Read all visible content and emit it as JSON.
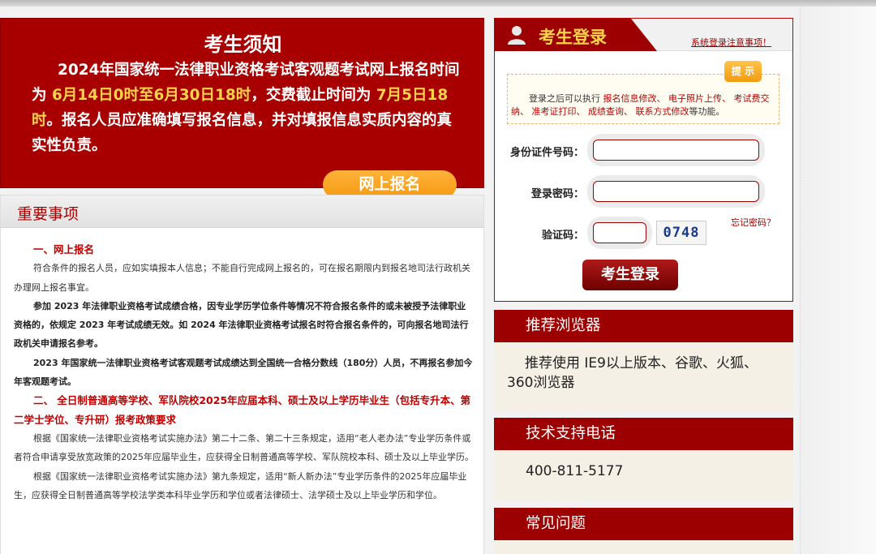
{
  "notice": {
    "title": "考生须知",
    "text_1": "2024年国家统一法律职业资格考试客观题考试网上报名时间为 ",
    "highlight_1": "6月14日0时至6月30日18时",
    "text_2": "，交费截止时间为 ",
    "highlight_2": "7月5日18时",
    "text_3": "。报名人员应准确填写报名信息，并对填报信息实质内容的真实性负责。",
    "enroll_button": "网上报名"
  },
  "matters": {
    "title": "重要事项",
    "section_1": "一、网上报名",
    "para_1": "符合条件的报名人员，应如实填报本人信息；不能自行完成网上报名的，可在报名期限内到报名地司法行政机关办理网上报名事宜。",
    "para_2": "参加 2023 年法律职业资格考试成绩合格，因专业学历学位条件等情况不符合报名条件的或未被授予法律职业资格的，依规定 2023 年考试成绩无效。如 2024 年法律职业资格考试报名时符合报名条件的，可向报名地司法行政机关申请报名参考。",
    "para_3": "2023 年国家统一法律职业资格考试客观题考试成绩达到全国统一合格分数线（180分）人员，不再报名参加今年客观题考试。",
    "section_2": "二、 全日制普通高等学校、军队院校2025年应届本科、硕士及以上学历毕业生（包括专升本、第二学士学位、专升研）报考政策要求",
    "para_4": "根据《国家统一法律职业资格考试实施办法》第二十二条、第二十三条规定，适用“老人老办法”专业学历条件或者符合申请享受放宽政策的2025年应届毕业生，应获得全日制普通高等学校、军队院校本科、硕士及以上毕业学历。",
    "para_5": "根据《国家统一法律职业资格考试实施办法》第九条规定，适用“新人新办法”专业学历条件的2025年应届毕业生，应获得全日制普通高等学校法学类本科毕业学历和学位或者法律硕士、法学硕士及以上毕业学历和学位。"
  },
  "login": {
    "title": "考生登录",
    "notice_link": "系统登录注意事项！",
    "tip_badge": "提 示",
    "tip_prefix": "登录之后可以执行 ",
    "tip_item_1": "报名信息修改、",
    "tip_item_2": "电子照片上传、",
    "tip_item_3": "考试费交纳、",
    "tip_item_4": "准考证打印、",
    "tip_item_5": "成绩查询、",
    "tip_item_6": "联系方式修改",
    "tip_suffix": "等功能。",
    "id_label": "身份证件号码：",
    "password_label": "登录密码：",
    "code_label": "验证码：",
    "forgot_link": "忘记密码？",
    "captcha": "0748",
    "submit": "考生登录"
  },
  "browser": {
    "title": "推荐浏览器",
    "text": "推荐使用 IE9以上版本、谷歌、火狐、360浏览器"
  },
  "support": {
    "title": "技术支持电话",
    "phone": "400-811-5177"
  },
  "faq": {
    "title": "常见问题"
  },
  "colors": {
    "brand_red": "#a80000",
    "highlight_yellow": "#ffd24a",
    "button_orange": "#f59a12"
  }
}
